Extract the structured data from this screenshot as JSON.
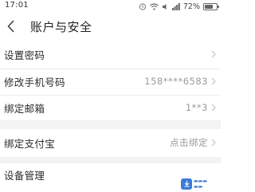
{
  "status_bar": {
    "time": "17:01",
    "battery_percent": "72%",
    "battery_level": 0.72,
    "icons": [
      "alarm-icon",
      "wifi-icon",
      "sound-icon",
      "signal-icon",
      "battery-icon"
    ]
  },
  "header": {
    "back_icon": "chevron-left-icon",
    "title": "账户与安全"
  },
  "settings": {
    "items": [
      {
        "label": "设置密码",
        "value": ""
      },
      {
        "label": "修改手机号码",
        "value": "158****6583"
      },
      {
        "label": "绑定邮箱",
        "value": "1**3"
      },
      {
        "label": "绑定支付宝",
        "value": "点击绑定"
      },
      {
        "label": "设备管理",
        "value": ""
      }
    ]
  },
  "colors": {
    "text_primary": "#222222",
    "text_secondary": "#9a9a9a",
    "divider": "#ececec",
    "section_gap": "#f3f3f3"
  }
}
